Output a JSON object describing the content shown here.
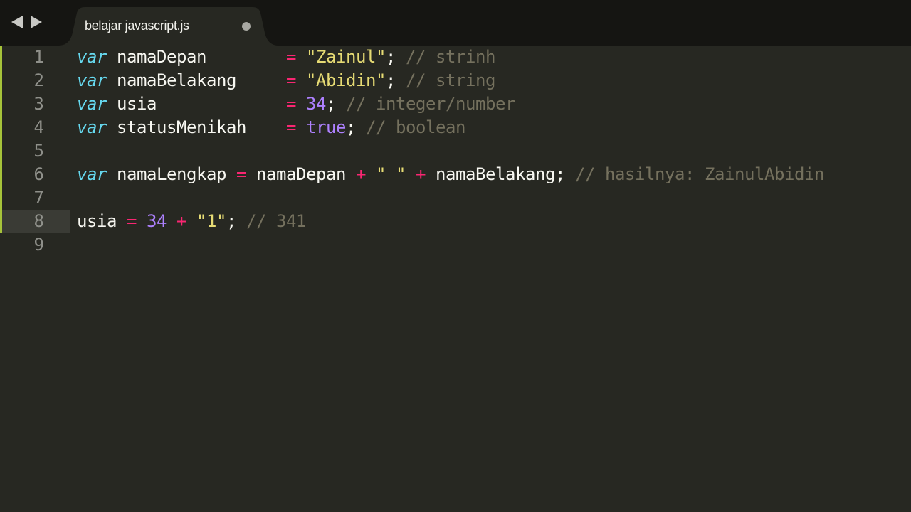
{
  "tab": {
    "filename": "belajar javascript.js",
    "modified": true
  },
  "navigation": {
    "back_icon": "triangle-left-icon",
    "forward_icon": "triangle-right-icon"
  },
  "editor": {
    "language": "javascript",
    "theme": "monokai",
    "current_line": 8,
    "colors": {
      "background": "#272822",
      "keyword": "#66d9ef",
      "operator": "#f92672",
      "string": "#e6db74",
      "number": "#ae81ff",
      "comment": "#75715e",
      "text": "#f8f8f2",
      "git_modified": "#a6c33a"
    },
    "lines": [
      {
        "number": "1",
        "tokens": [
          {
            "type": "keyword",
            "text": "var"
          },
          {
            "type": "plain",
            "text": " namaDepan        "
          },
          {
            "type": "operator",
            "text": "="
          },
          {
            "type": "plain",
            "text": " "
          },
          {
            "type": "string",
            "text": "\"Zainul\""
          },
          {
            "type": "plain",
            "text": "; "
          },
          {
            "type": "comment",
            "text": "// strinh"
          }
        ]
      },
      {
        "number": "2",
        "tokens": [
          {
            "type": "keyword",
            "text": "var"
          },
          {
            "type": "plain",
            "text": " namaBelakang     "
          },
          {
            "type": "operator",
            "text": "="
          },
          {
            "type": "plain",
            "text": " "
          },
          {
            "type": "string",
            "text": "\"Abidin\""
          },
          {
            "type": "plain",
            "text": "; "
          },
          {
            "type": "comment",
            "text": "// string"
          }
        ]
      },
      {
        "number": "3",
        "tokens": [
          {
            "type": "keyword",
            "text": "var"
          },
          {
            "type": "plain",
            "text": " usia             "
          },
          {
            "type": "operator",
            "text": "="
          },
          {
            "type": "plain",
            "text": " "
          },
          {
            "type": "number",
            "text": "34"
          },
          {
            "type": "plain",
            "text": "; "
          },
          {
            "type": "comment",
            "text": "// integer/number"
          }
        ]
      },
      {
        "number": "4",
        "tokens": [
          {
            "type": "keyword",
            "text": "var"
          },
          {
            "type": "plain",
            "text": " statusMenikah    "
          },
          {
            "type": "operator",
            "text": "="
          },
          {
            "type": "plain",
            "text": " "
          },
          {
            "type": "constant",
            "text": "true"
          },
          {
            "type": "plain",
            "text": "; "
          },
          {
            "type": "comment",
            "text": "// boolean"
          }
        ]
      },
      {
        "number": "5",
        "tokens": []
      },
      {
        "number": "6",
        "tokens": [
          {
            "type": "keyword",
            "text": "var"
          },
          {
            "type": "plain",
            "text": " namaLengkap "
          },
          {
            "type": "operator",
            "text": "="
          },
          {
            "type": "plain",
            "text": " namaDepan "
          },
          {
            "type": "operator",
            "text": "+"
          },
          {
            "type": "plain",
            "text": " "
          },
          {
            "type": "string",
            "text": "\" \""
          },
          {
            "type": "plain",
            "text": " "
          },
          {
            "type": "operator",
            "text": "+"
          },
          {
            "type": "plain",
            "text": " namaBelakang; "
          },
          {
            "type": "comment",
            "text": "// hasilnya: ZainulAbidin"
          }
        ]
      },
      {
        "number": "7",
        "tokens": []
      },
      {
        "number": "8",
        "tokens": [
          {
            "type": "plain",
            "text": "usia "
          },
          {
            "type": "operator",
            "text": "="
          },
          {
            "type": "plain",
            "text": " "
          },
          {
            "type": "number",
            "text": "34"
          },
          {
            "type": "plain",
            "text": " "
          },
          {
            "type": "operator",
            "text": "+"
          },
          {
            "type": "plain",
            "text": " "
          },
          {
            "type": "string",
            "text": "\"1\""
          },
          {
            "type": "plain",
            "text": "; "
          },
          {
            "type": "comment",
            "text": "// 341"
          }
        ]
      },
      {
        "number": "9",
        "tokens": []
      }
    ]
  }
}
